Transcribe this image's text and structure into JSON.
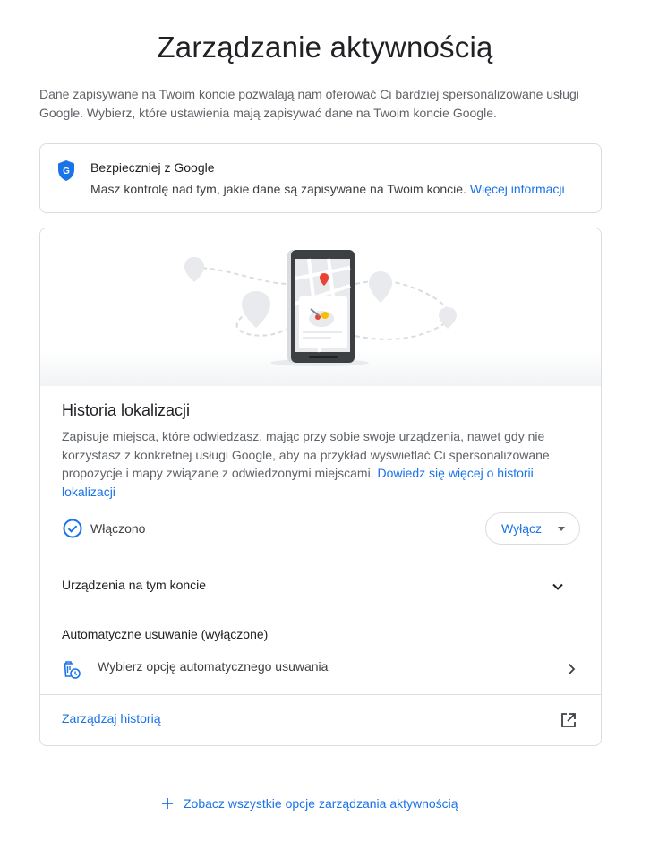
{
  "page": {
    "title": "Zarządzanie aktywnością",
    "intro": "Dane zapisywane na Twoim koncie pozwalają nam oferować Ci bardziej spersonalizowane usługi Google. Wybierz, które ustawienia mają zapisywać dane na Twoim koncie Google."
  },
  "safety_card": {
    "icon": "google-shield-icon",
    "title": "Bezpieczniej z Google",
    "description": "Masz kontrolę nad tym, jakie dane są zapisywane na Twoim koncie.",
    "link": "Więcej informacji"
  },
  "location_history": {
    "title": "Historia lokalizacji",
    "description": "Zapisuje miejsca, które odwiedzasz, mając przy sobie swoje urządzenia, nawet gdy nie korzystasz z konkretnej usługi Google, aby na przykład wyświetlać Ci spersonalizowane propozycje i mapy związane z odwiedzonymi miejscami.",
    "learn_more_link": "Dowiedz się więcej o historii lokalizacji",
    "status": "Włączono",
    "off_button": "Wyłącz",
    "devices_label": "Urządzenia na tym koncie",
    "auto_delete_title": "Automatyczne usuwanie (wyłączone)",
    "auto_delete_option": "Wybierz opcję automatycznego usuwania",
    "manage_history": "Zarządzaj historią"
  },
  "footer": {
    "see_all": "Zobacz wszystkie opcje zarządzania aktywnością"
  },
  "colors": {
    "accent": "#1a73e8",
    "text_primary": "#202124",
    "text_secondary": "#5f6368",
    "border": "#dadce0"
  }
}
